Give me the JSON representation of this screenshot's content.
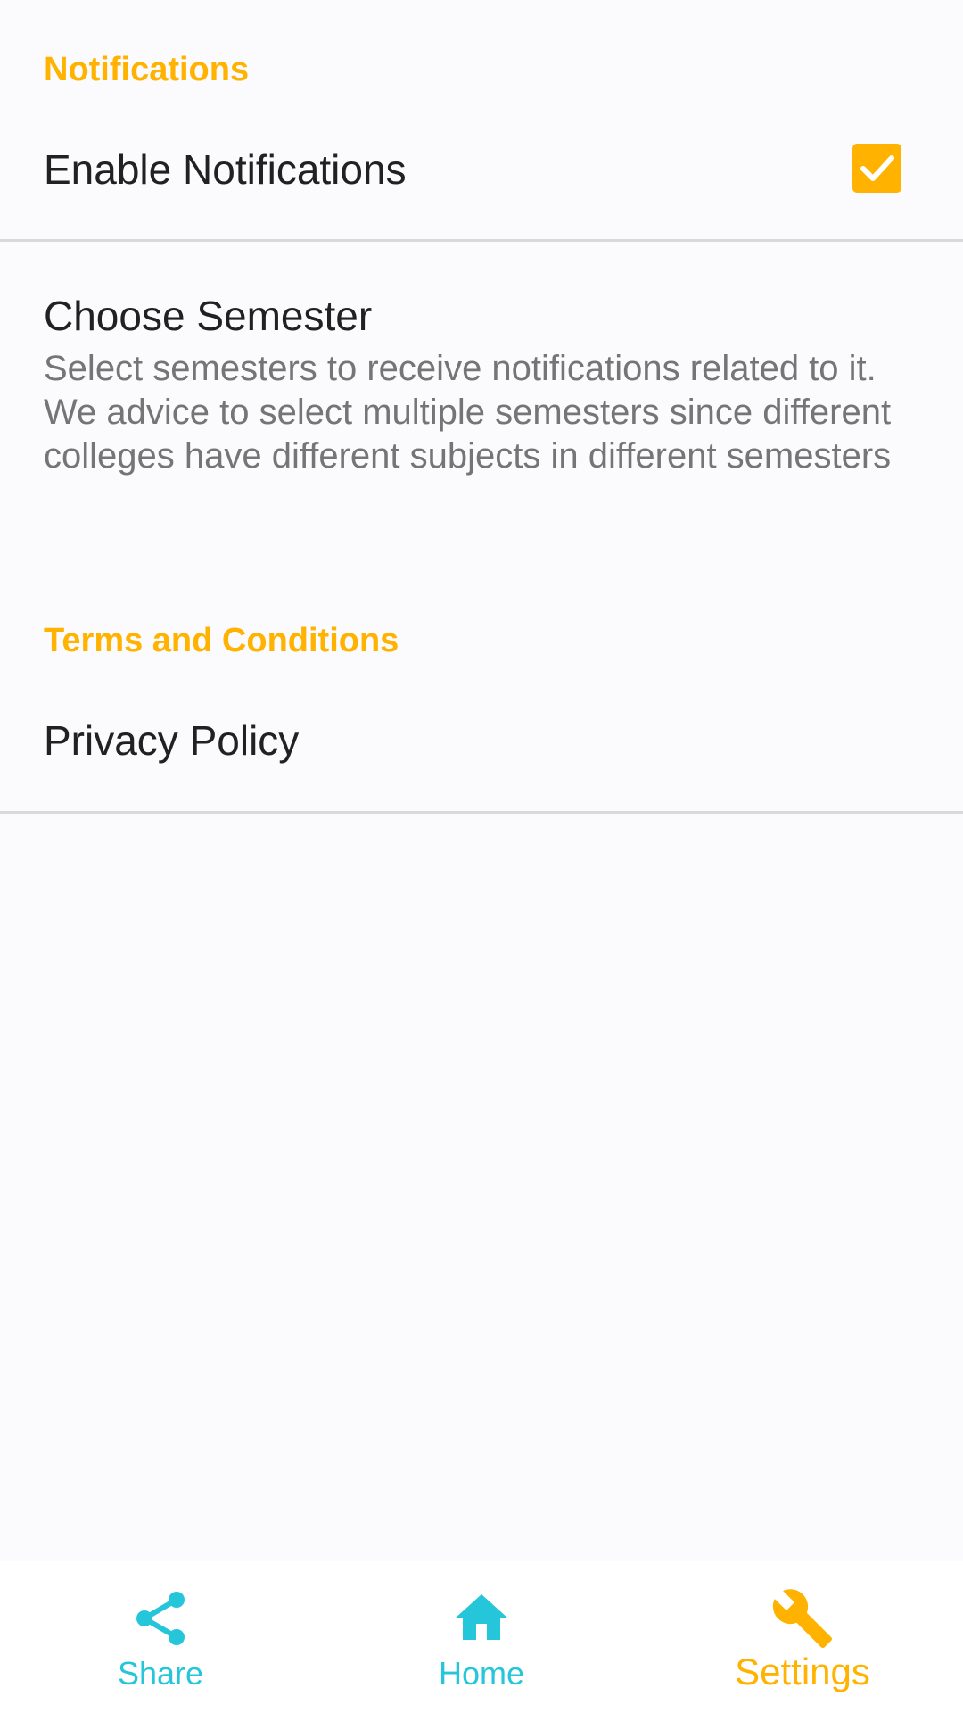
{
  "sections": {
    "notifications": {
      "header": "Notifications",
      "enable_notifications": {
        "title": "Enable Notifications",
        "checked": true
      },
      "choose_semester": {
        "title": "Choose Semester",
        "summary": "Select semesters to receive notifications related to it. We advice to select multiple semesters since different colleges have different subjects in different semesters"
      }
    },
    "terms": {
      "header": "Terms and Conditions",
      "privacy_policy": {
        "title": "Privacy Policy"
      }
    }
  },
  "bottom_nav": {
    "items": [
      {
        "label": "Share",
        "icon": "share-icon",
        "active": false
      },
      {
        "label": "Home",
        "icon": "home-icon",
        "active": false
      },
      {
        "label": "Settings",
        "icon": "wrench-icon",
        "active": true
      }
    ]
  },
  "colors": {
    "accent": "#ffb300",
    "nav_inactive": "#26c6da",
    "background": "#fbfafc"
  }
}
